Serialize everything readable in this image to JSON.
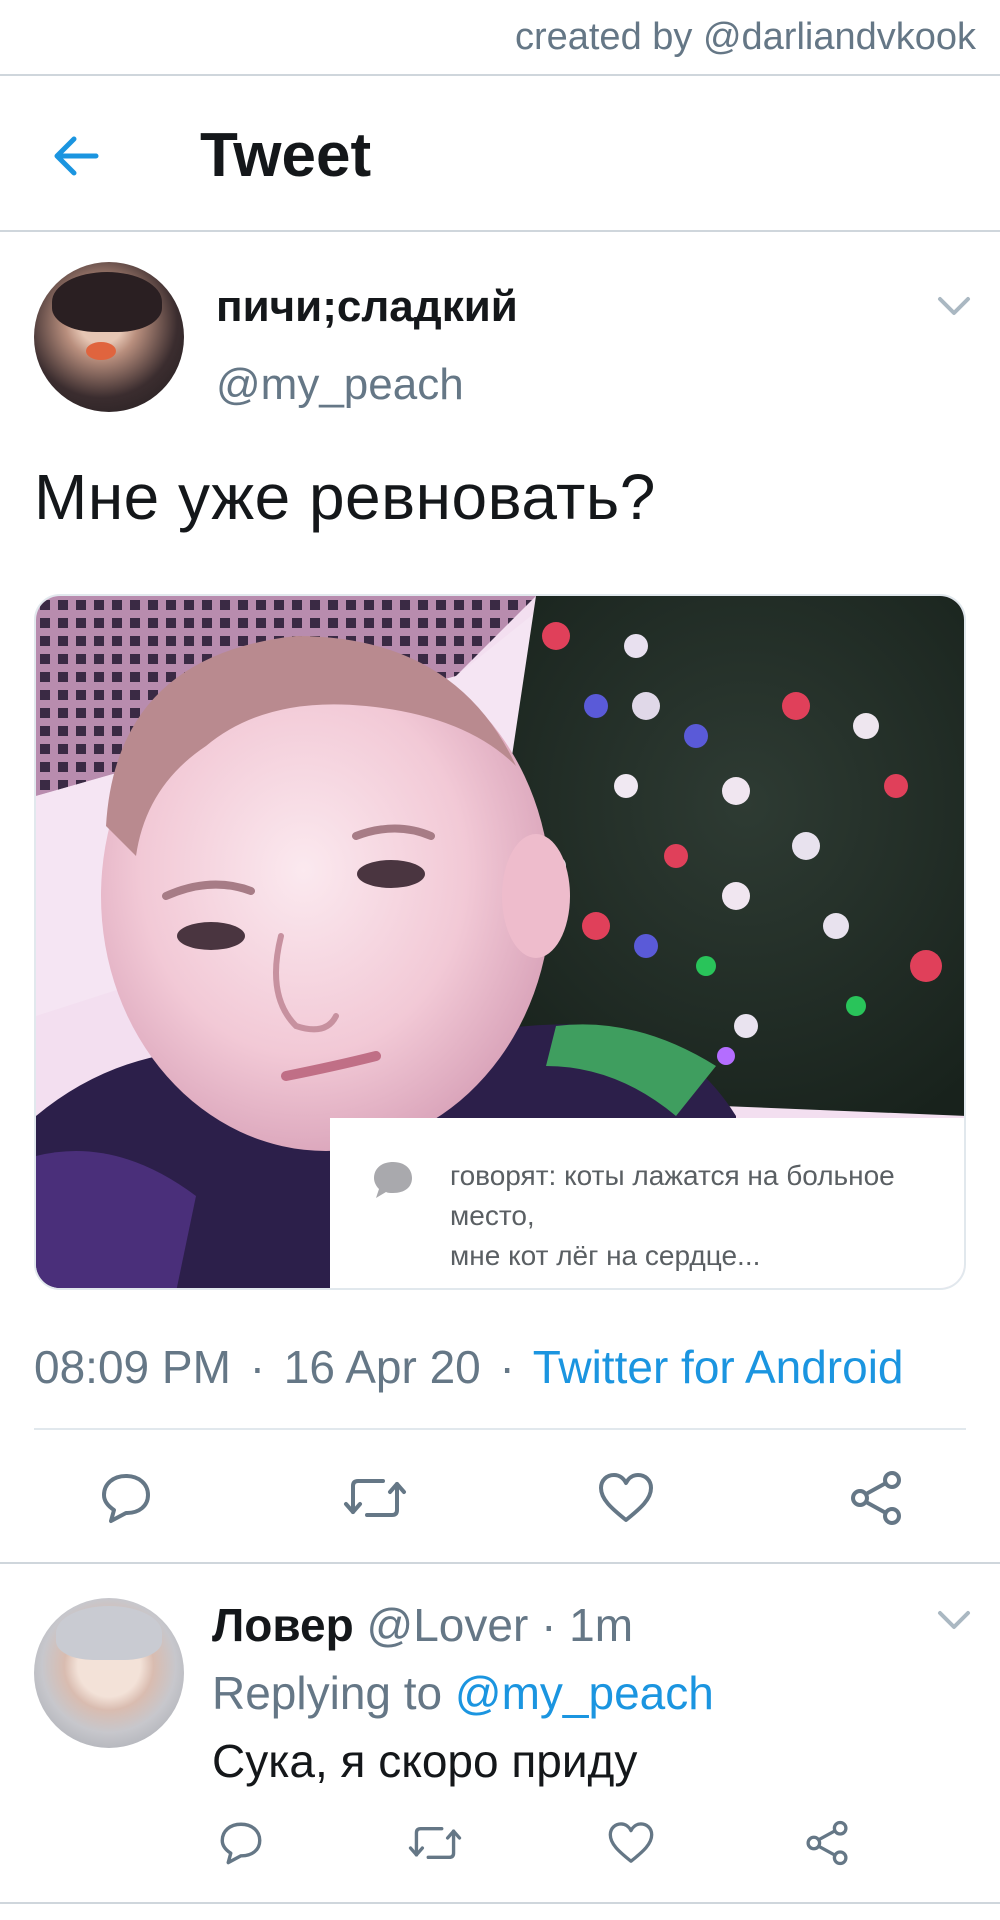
{
  "credit": {
    "text": "created by @darliandvkook"
  },
  "header": {
    "title": "Tweet",
    "back_icon": "arrow-left-icon"
  },
  "tweet": {
    "display_name": "пичи;сладкий",
    "handle": "@my_peach",
    "text": "Мне уже ревновать?",
    "image": {
      "description_icon": "photo-selfie",
      "quote": {
        "icon": "speech-bubble-icon",
        "lines": [
          "говорят: коты лажатся на больное",
          "место,",
          "мне кот лёг на сердце..."
        ]
      }
    },
    "time": "08:09 PM",
    "date": "16 Apr 20",
    "source": "Twitter for Android",
    "separator": "·",
    "actions": [
      "reply-icon",
      "retweet-icon",
      "like-icon",
      "share-icon"
    ]
  },
  "reply": {
    "display_name": "Ловер",
    "handle": "@Lover",
    "time": "1m",
    "separator": "·",
    "replying_prefix": "Replying to",
    "replying_to": "@my_peach",
    "text": "Сука, я скоро приду",
    "actions": [
      "reply-icon",
      "retweet-icon",
      "like-icon",
      "share-icon"
    ]
  },
  "colors": {
    "accent": "#1b95e0",
    "text_primary": "#14171a",
    "text_secondary": "#657786",
    "divider": "#e1e8ed"
  }
}
